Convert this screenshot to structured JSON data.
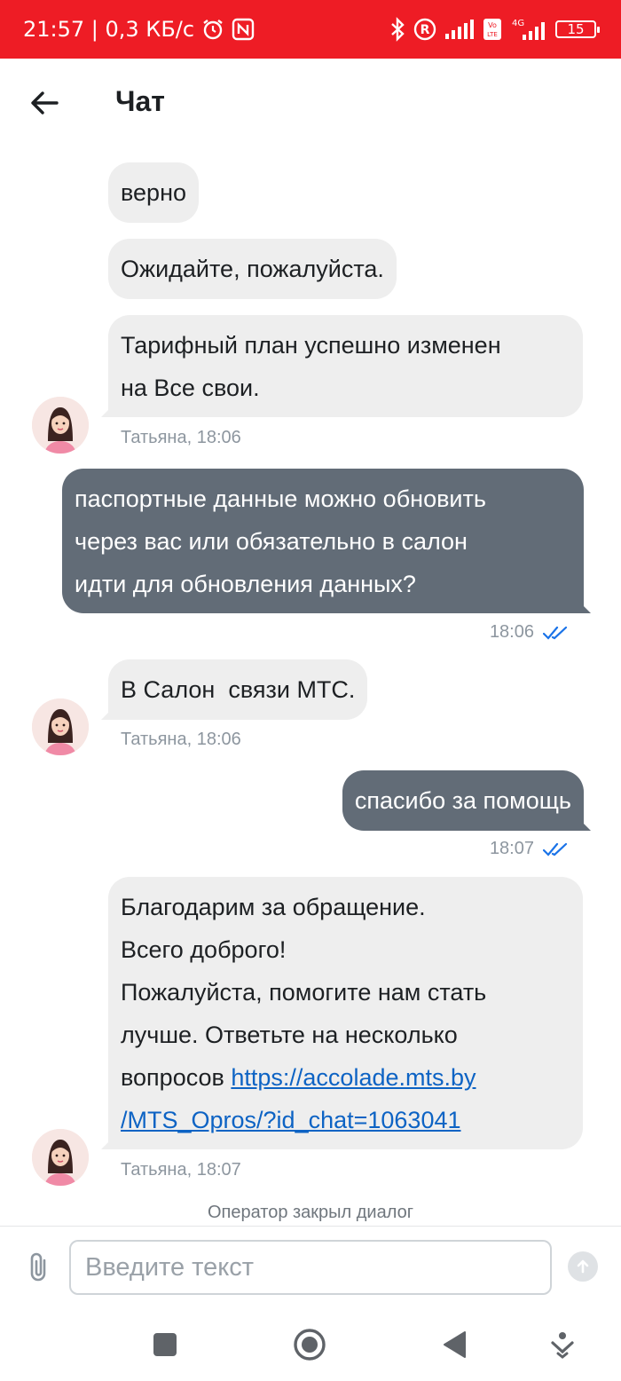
{
  "status_bar": {
    "time_speed": "21:57 | 0,3 КБ/с",
    "network_4g": "4G",
    "battery": "15",
    "bg_color": "#ee1c25"
  },
  "header": {
    "title": "Чат"
  },
  "messages": [
    {
      "direction": "incoming",
      "lines": [
        "верно"
      ]
    },
    {
      "direction": "incoming",
      "lines": [
        "Ожидайте, пожалуйста."
      ]
    },
    {
      "direction": "incoming",
      "lines": [
        "Тарифный план успешно изменен",
        "на Все свои."
      ],
      "meta": "Татьяна, 18:06"
    },
    {
      "direction": "outgoing",
      "lines": [
        "паспортные данные можно обновить",
        "через вас или обязательно в салон",
        "идти для обновления данных?"
      ],
      "time": "18:06"
    },
    {
      "direction": "incoming",
      "lines": [
        "В Салон  связи МТС."
      ],
      "meta": "Татьяна, 18:06"
    },
    {
      "direction": "outgoing",
      "lines": [
        "спасибо за помощь"
      ],
      "time": "18:07"
    },
    {
      "direction": "incoming",
      "lines": [
        "Благодарим за обращение.",
        "Всего доброго!",
        "Пожалуйста, помогите нам стать",
        "лучше. Ответьте на несколько"
      ],
      "last_line_prefix": "вопросов ",
      "link_part1": "https://accolade.mts.by",
      "link_part2": "/MTS_Opros/?id_chat=1063041",
      "meta": "Татьяна, 18:07"
    }
  ],
  "closed_note": "Оператор закрыл диалог",
  "input": {
    "placeholder": "Введите текст",
    "value": ""
  },
  "icons": {
    "back": "arrow-left-icon",
    "attach": "paperclip-icon",
    "send": "send-arrow-up-icon",
    "read_receipt": "double-check-icon"
  },
  "colors": {
    "incoming_bubble": "#eeeeee",
    "outgoing_bubble": "#626c77",
    "link": "#0d63c4",
    "read_check": "#1a73e8"
  }
}
